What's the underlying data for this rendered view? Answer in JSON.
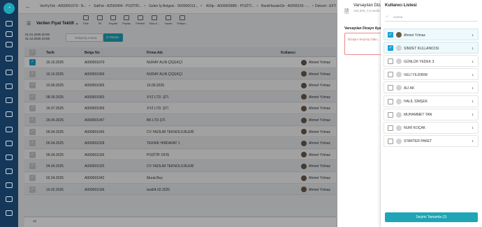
{
  "tabs": [
    "VerFiyTek - A000001070 - N...",
    "SatFat - A2500404 - POZİTİF...",
    "Gelen İş Belgesi - S00000013...",
    "AlSip - A000000885 - POZİTİ...",
    "BankHavaleGir - A0000156 - ...",
    "Dekont - EFT: YKB Ana - ..."
  ],
  "header": {
    "title": "Verilen Fiyat Teklifi"
  },
  "toolbar": [
    "Ekle",
    "Sil",
    "Kaydet",
    "Paylaş",
    "Filtreler",
    "Diza.A...",
    "Yazdır",
    "Gelişm..."
  ],
  "filter": {
    "date_from": "01.01.2025 00:00",
    "date_to": "31.12.2025 23:59",
    "search_placeholder": "Gelişmiş Arama",
    "filter_label": "Filtrele"
  },
  "grid": {
    "columns": [
      "Tarih",
      "Belge No",
      "Firma Adı",
      "Kullanıcı"
    ],
    "rows": [
      {
        "date": "16.10.2025",
        "doc": "A000001070",
        "firm": "NURAY ALIN ÇİÇEKÇİ",
        "user": "Ahmet Yılmaz",
        "checked": true
      },
      {
        "date": "16.10.2025",
        "doc": "A000001069",
        "firm": "NURAY ALIN ÇİÇEKÇİ",
        "user": "Ahmet Yılmaz",
        "checked": false
      },
      {
        "date": "10.09.2025",
        "doc": "A000001065",
        "firm": "10.09.2025",
        "user": "Ahmet Yılmaz",
        "checked": false
      },
      {
        "date": "08.09.2025",
        "doc": "A000001063",
        "firm": "XYZ LTD. ŞTİ.",
        "user": "Ahmet Yılmaz",
        "checked": false
      },
      {
        "date": "16.07.2025",
        "doc": "A000001059",
        "firm": "XYZ LTD. ŞTİ.",
        "user": "Ahmet Yılmaz",
        "checked": false
      },
      {
        "date": "29.04.2025",
        "doc": "A000001047",
        "firm": "BK LTD.ŞTİ.",
        "user": "Ahmet Yılmaz",
        "checked": false
      },
      {
        "date": "09.04.2025",
        "doc": "A000001043",
        "firm": "CV YAZILIM TEKNOLOJİLERİ",
        "user": "Ahmet Yılmaz",
        "checked": false
      },
      {
        "date": "09.04.2025",
        "doc": "A000001028",
        "firm": "TEKNİK HIRDAVAT 1",
        "user": "Ahmet Yılmaz",
        "checked": false
      },
      {
        "date": "09.04.2025",
        "doc": "A000001026",
        "firm": "POZİTİF OFİS",
        "user": "Ahmet Yılmaz",
        "checked": false
      },
      {
        "date": "04.04.2025",
        "doc": "A000001025",
        "firm": "CV YAZILIM TEKNOLOJİLERİ",
        "user": "Ahmet Yılmaz",
        "checked": false
      },
      {
        "date": "02.04.2025",
        "doc": "A000001042",
        "firm": "Murat Bey",
        "user": "Ahmet Yılmaz",
        "checked": false
      },
      {
        "date": "19.02.2025",
        "doc": "A000001036",
        "firm": "test04.02.2025",
        "user": "Ahmet Yılmaz",
        "checked": false
      }
    ],
    "footer_count": "12"
  },
  "design_panel": {
    "title": "Varsayılan Dizayn",
    "subtitle": "100,300_7,0,Verile...",
    "label": "Varsayılan Dizayn Aya...",
    "input_placeholder": "Dizaynı Seçmiş Olan..."
  },
  "user_panel": {
    "title": "Kullanıcı Listesi",
    "search_placeholder": "Arama",
    "users": [
      {
        "name": "Ahmet Yılmaz",
        "num": "1",
        "checked": true,
        "photo": true
      },
      {
        "name": "SİMZET KULLANICISI",
        "num": "1",
        "checked": true,
        "photo": false
      },
      {
        "name": "GÜNLÜK YEDEK 3",
        "num": "1",
        "checked": false,
        "photo": false
      },
      {
        "name": "VELİ YILDIRIM",
        "num": "1",
        "checked": false,
        "photo": false
      },
      {
        "name": "ALİ AK",
        "num": "1",
        "checked": false,
        "photo": false
      },
      {
        "name": "HALİL SİMŞEK",
        "num": "1",
        "checked": false,
        "photo": false
      },
      {
        "name": "MUHAMMET TAN",
        "num": "1",
        "checked": false,
        "photo": false
      },
      {
        "name": "NURİ KOÇAK",
        "num": "1",
        "checked": false,
        "photo": false
      },
      {
        "name": "STARTER PAKET",
        "num": "1",
        "checked": false,
        "photo": false
      }
    ],
    "button_label": "Seçimi Tamamla (2)"
  },
  "colors": {
    "sidebar": "#14375a",
    "accent": "#1fa5b5",
    "check": "#1aa0d8"
  }
}
